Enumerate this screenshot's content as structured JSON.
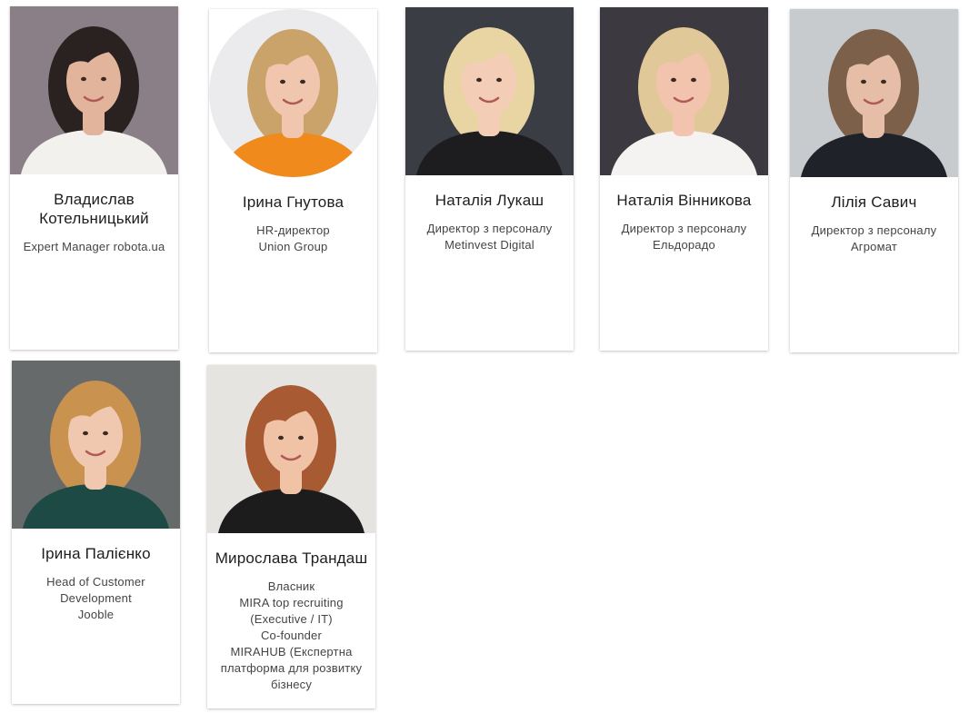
{
  "speakers": [
    {
      "name": "Владислав Котельницький",
      "role": "Expert Manager robota.ua",
      "photo_icon": "speaker-portrait",
      "colors": {
        "bg": "#8a7f86",
        "hair": "#2a2220",
        "skin": "#e2b49c",
        "clothes": "#f3f1ee"
      }
    },
    {
      "name": "Ірина Гнутова",
      "role": "HR-директор\nUnion Group",
      "photo_icon": "speaker-portrait",
      "colors": {
        "bg": "#ebebee",
        "hair": "#c9a36a",
        "skin": "#f0c6ae",
        "clothes": "#f08a1c"
      }
    },
    {
      "name": "Наталія Лукаш",
      "role": "Директор з персоналу\nMetinvest Digital",
      "photo_icon": "speaker-portrait",
      "colors": {
        "bg": "#3a3d43",
        "hair": "#e9d4a4",
        "skin": "#f3cdb6",
        "clothes": "#1d1d20"
      }
    },
    {
      "name": "Наталія Вінникова",
      "role": "Директор з персоналу\nЕльдорадо",
      "photo_icon": "speaker-portrait",
      "colors": {
        "bg": "#3c3a40",
        "hair": "#e0c898",
        "skin": "#f2c4ae",
        "clothes": "#f5f2f2"
      }
    },
    {
      "name": "Лілія Савич",
      "role": "Директор з персоналу\nАгромат",
      "photo_icon": "speaker-portrait",
      "colors": {
        "bg": "#c8cbcd",
        "hair": "#7c604a",
        "skin": "#e6bea8",
        "clothes": "#1f2329"
      }
    },
    {
      "name": "Ірина Палієнко",
      "role": "Head of Customer\nDevelopment\nJooble",
      "photo_icon": "speaker-portrait",
      "colors": {
        "bg": "#666a6b",
        "hair": "#c9924f",
        "skin": "#f0c8b0",
        "clothes": "#1d4a44"
      }
    },
    {
      "name": "Мирослава Трандаш",
      "role": "Власник\nMIRA top recruiting\n(Executive / IT)\nCo-founder\nMIRAHUB (Експертна\nплатформа для розвитку\nбізнесу",
      "photo_icon": "speaker-portrait",
      "colors": {
        "bg": "#e6e4e0",
        "hair": "#a85a32",
        "skin": "#f0c2a6",
        "clothes": "#1c1c1c"
      }
    }
  ]
}
